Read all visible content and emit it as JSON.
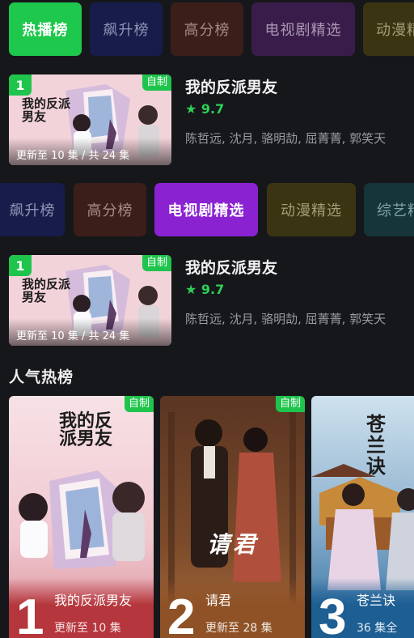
{
  "tabs_top": [
    {
      "label": "热播榜",
      "style": "green"
    },
    {
      "label": "飙升榜",
      "style": "navy"
    },
    {
      "label": "高分榜",
      "style": "brown"
    },
    {
      "label": "电视剧精选",
      "style": "purple"
    },
    {
      "label": "动漫精",
      "style": "olive"
    }
  ],
  "tabs_second": [
    {
      "label": "飙升榜",
      "style": "navy"
    },
    {
      "label": "高分榜",
      "style": "brown"
    },
    {
      "label": "电视剧精选",
      "style": "purple-active"
    },
    {
      "label": "动漫精选",
      "style": "olive"
    },
    {
      "label": "综艺精",
      "style": "teal"
    }
  ],
  "featured": [
    {
      "rank": "1",
      "badge": "自制",
      "title": "我的反派男友",
      "score": "9.7",
      "cast": "陈哲远, 沈月, 骆明劼, 屈菁菁, 郭笑天",
      "episodes": "更新至 10 集 / 共 24 集",
      "poster_text": "我的反派男友"
    },
    {
      "rank": "1",
      "badge": "自制",
      "title": "我的反派男友",
      "score": "9.7",
      "cast": "陈哲远, 沈月, 骆明劼, 屈菁菁, 郭笑天",
      "episodes": "更新至 10 集 / 共 24 集",
      "poster_text": "我的反派男友"
    }
  ],
  "popular": {
    "title": "人气热榜",
    "items": [
      {
        "rank": "1",
        "name": "我的反派男友",
        "sub": "更新至 10 集",
        "badge": "自制",
        "band_color": "#b5363c",
        "poster_text": "我的反派男友"
      },
      {
        "rank": "2",
        "name": "请君",
        "sub": "更新至 28 集",
        "badge": "自制",
        "band_color": "#8f5226",
        "poster_text": "请君"
      },
      {
        "rank": "3",
        "name": "苍兰诀",
        "sub": "36 集全",
        "badge": "",
        "band_color": "#1d5e93",
        "poster_text": "苍兰诀"
      }
    ]
  },
  "colors": {
    "background": "#16171b",
    "accent_green": "#1ec84c",
    "accent_purple": "#8a22d2",
    "score_green": "#2fcf57"
  },
  "icons": {
    "score": "star-icon"
  }
}
